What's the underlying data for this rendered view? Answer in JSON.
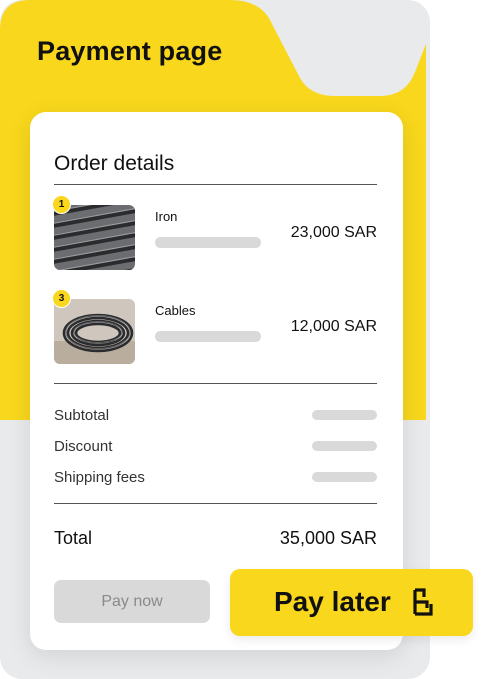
{
  "header": {
    "title": "Payment page"
  },
  "order": {
    "title": "Order details",
    "items": [
      {
        "badge": "1",
        "name": "Iron",
        "price": "23,000 SAR",
        "image_icon": "iron-bars-image"
      },
      {
        "badge": "3",
        "name": "Cables",
        "price": "12,000 SAR",
        "image_icon": "cable-coil-image"
      }
    ]
  },
  "summary": {
    "subtotal_label": "Subtotal",
    "discount_label": "Discount",
    "shipping_label": "Shipping fees",
    "total_label": "Total",
    "total_value": "35,000 SAR"
  },
  "actions": {
    "pay_now_label": "Pay now",
    "pay_later_label": "Pay later",
    "pay_later_icon": "brand-logo-icon"
  },
  "colors": {
    "accent": "#f8d71c",
    "background_panel": "#e9eaec",
    "placeholder": "#d9d9d9",
    "disabled_text": "#8a8a8a"
  }
}
